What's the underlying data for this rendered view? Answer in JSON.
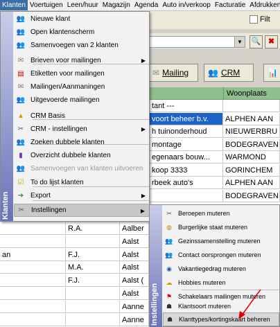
{
  "menubar": {
    "items": [
      "Klanten",
      "Voertuigen",
      "Leen/huur",
      "Magazijn",
      "Agenda",
      "Auto in/verkoop",
      "Facturatie",
      "Afdrukken"
    ]
  },
  "toolbar": {
    "filter_label": "Filt",
    "mailing_label": "Mailing",
    "crm_label": "CRM"
  },
  "grid": {
    "header_woonplaats": "Woonplaats",
    "rows_right": [
      {
        "name": "tant ---",
        "city": ""
      },
      {
        "name": "voort beheer b.v.",
        "city": "ALPHEN AAN"
      },
      {
        "name": "h tuinonderhoud",
        "city": "NIEUWERBRU"
      },
      {
        "name": "montage",
        "city": "BODEGRAVEN"
      },
      {
        "name": "egenaars bouw...",
        "city": "WARMOND"
      },
      {
        "name": "koop 3333",
        "city": "GORINCHEM"
      },
      {
        "name": "rbeek auto's",
        "city": "ALPHEN AAN"
      },
      {
        "name": "",
        "city": "BODEGRAVEN"
      }
    ],
    "rows_bottom": [
      {
        "a": "",
        "b": "R.A.",
        "c": "Aalber"
      },
      {
        "a": "",
        "b": "",
        "c": "Aalst"
      },
      {
        "a": "an",
        "b": "F.J.",
        "c": "Aalst"
      },
      {
        "a": "",
        "b": "M.A.",
        "c": "Aalst"
      },
      {
        "a": "",
        "b": "F.J.",
        "c": "Aalst ("
      },
      {
        "a": "",
        "b": "",
        "c": "Aalst"
      },
      {
        "a": "",
        "b": "",
        "c": "Aanne"
      },
      {
        "a": "",
        "b": "",
        "c": "Aanne"
      }
    ]
  },
  "menu": {
    "stripe_label": "Klanten",
    "items": [
      {
        "label": "Nieuwe klant",
        "icon": "people-icon"
      },
      {
        "label": "Open klantenscherm",
        "icon": "people-icon"
      },
      {
        "label": "Samenvoegen van 2 klanten",
        "icon": "people-icon"
      },
      {
        "label": "Brieven voor mailingen",
        "icon": "letter-icon",
        "submenu": true
      },
      {
        "label": "Etiketten voor mailingen",
        "icon": "label-icon"
      },
      {
        "label": "Mailingen/Aanmaningen",
        "icon": "letter-icon"
      },
      {
        "label": "Uitgevoerde mailingen",
        "icon": "people-icon"
      },
      {
        "label": "CRM Basis",
        "icon": "crm-icon"
      },
      {
        "label": "CRM - instellingen",
        "icon": "tools-icon",
        "submenu": true
      },
      {
        "label": "Zoeken dubbele klanten",
        "icon": "people-icon"
      },
      {
        "label": "Overzicht dubbele klanten",
        "icon": "book-icon"
      },
      {
        "label": "Samenvoegen van klanten uitvoeren",
        "icon": "people-icon",
        "disabled": true
      },
      {
        "label": "To do lijst klanten",
        "icon": "todo-icon"
      },
      {
        "label": "Export",
        "icon": "export-icon",
        "submenu": true
      },
      {
        "label": "Instellingen",
        "icon": "tools-icon",
        "submenu": true,
        "highlighted": true
      }
    ]
  },
  "submenu": {
    "stripe_label": "Instellingen",
    "items": [
      {
        "label": "Beroepen muteren",
        "icon": "tools-icon"
      },
      {
        "label": "Burgerlijke staat muteren",
        "icon": "ring-icon"
      },
      {
        "label": "Gezinssamenstelling muteren",
        "icon": "people-icon"
      },
      {
        "label": "Contact oorsprongen muteren",
        "icon": "people-icon"
      },
      {
        "label": "Vakantiegedrag muteren",
        "icon": "globe-icon"
      },
      {
        "label": "Hobbies muteren",
        "icon": "hobby-icon"
      },
      {
        "label": "Schakelaars mailingen muteren",
        "icon": "flag-icon"
      },
      {
        "label": "Klantsoort muteren",
        "icon": "person-icon"
      },
      {
        "label": "Klanttypes/kortingskaart beheren",
        "icon": "person-icon",
        "highlighted": true
      }
    ]
  },
  "colors": {
    "selection": "#1c64c8",
    "grid_header": "#8fbe8f",
    "stripe_top": "#c7cde8",
    "stripe_bottom": "#6a72b8",
    "annotation_arrow": "#e00000"
  }
}
